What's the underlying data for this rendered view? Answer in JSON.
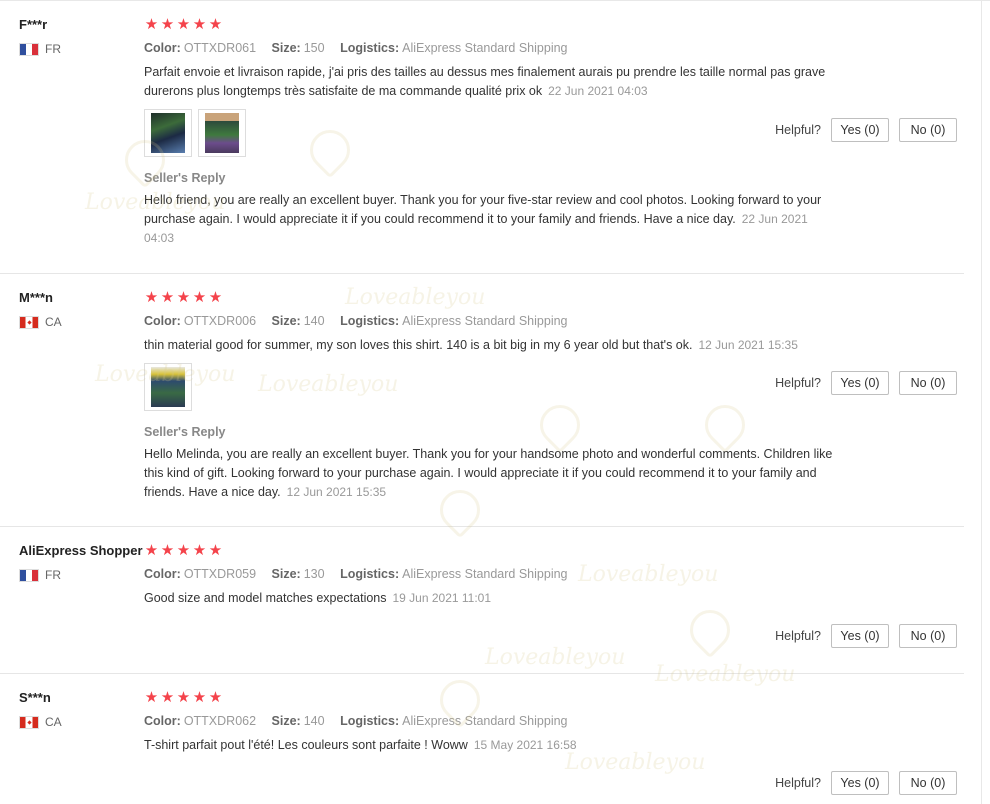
{
  "labels": {
    "color": "Color:",
    "size": "Size:",
    "logistics": "Logistics:",
    "seller_reply": "Seller's Reply",
    "helpful": "Helpful?",
    "yes": "Yes (0)",
    "no": "No (0)"
  },
  "watermark_text": "Loveableyou",
  "colors": {
    "star": "#f4434b",
    "meta": "#999999",
    "border": "#e6e6e6"
  },
  "reviews": [
    {
      "buyer": "F***r",
      "country": "FR",
      "flag": "fr-flag-icon",
      "rating": 5,
      "color": "OTTXDR061",
      "size": "150",
      "logistics": "AliExpress Standard Shipping",
      "text": "Parfait envoie et livraison rapide, j'ai pris des tailles au dessus mes finalement aurais pu prendre les taille normal pas grave durerons plus longtemps très satisfaite de ma commande qualité prix ok",
      "date": "22 Jun 2021 04:03",
      "photos": [
        "review-photo-1",
        "review-photo-2"
      ],
      "reply": "Hello friend, you are really an excellent buyer. Thank you for your five-star review and cool photos. Looking forward to your purchase again. I would appreciate it if you could recommend it to your family and friends. Have a nice day.",
      "reply_date": "22 Jun 2021 04:03"
    },
    {
      "buyer": "M***n",
      "country": "CA",
      "flag": "ca-flag-icon",
      "rating": 5,
      "color": "OTTXDR006",
      "size": "140",
      "logistics": "AliExpress Standard Shipping",
      "text": "thin material good for summer, my son loves this shirt. 140 is a bit big in my 6 year old but that's ok.",
      "date": "12 Jun 2021 15:35",
      "photos": [
        "review-photo-1"
      ],
      "reply": "Hello Melinda, you are really an excellent buyer. Thank you for your handsome photo and wonderful comments. Children like this kind of gift. Looking forward to your purchase again. I would appreciate it if you could recommend it to your family and friends. Have a nice day.",
      "reply_date": "12 Jun 2021 15:35"
    },
    {
      "buyer": "AliExpress Shopper",
      "country": "FR",
      "flag": "fr-flag-icon",
      "rating": 5,
      "color": "OTTXDR059",
      "size": "130",
      "logistics": "AliExpress Standard Shipping",
      "text": "Good size and model matches expectations",
      "date": "19 Jun 2021 11:01"
    },
    {
      "buyer": "S***n",
      "country": "CA",
      "flag": "ca-flag-icon",
      "rating": 5,
      "color": "OTTXDR062",
      "size": "140",
      "logistics": "AliExpress Standard Shipping",
      "text": "T-shirt parfait pout l'été! Les couleurs sont parfaite ! Woww",
      "date": "15 May 2021 16:58"
    }
  ]
}
